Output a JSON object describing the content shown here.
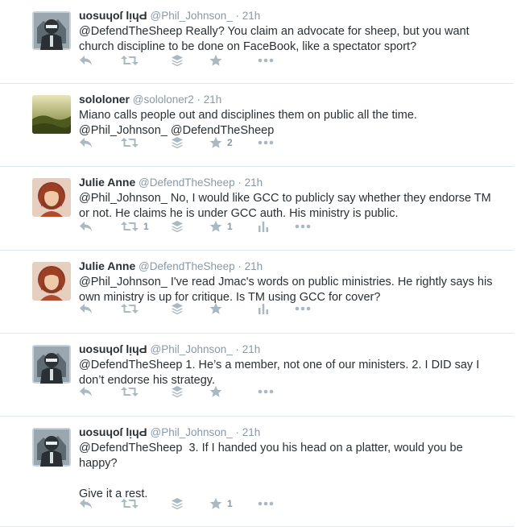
{
  "tweets": [
    {
      "fullname": "uosuɥoſ lᴉɥԀ",
      "username": "@Phil_Johnson_",
      "time": "21h",
      "text": "@DefendTheSheep Really? You claim an advocate for sheep, but you want church discipline to be done on FaceBook, like a spectator sport?",
      "avatar": "phil",
      "retweets": "",
      "favorites": "",
      "has_stats": false
    },
    {
      "fullname": "sololoner",
      "username": "@sololoner2",
      "time": "21h",
      "text": "Miano calls people out and disciplines them on public all the time. @Phil_Johnson_ @DefendTheSheep",
      "avatar": "sololoner",
      "retweets": "",
      "favorites": "2",
      "has_stats": false
    },
    {
      "fullname": "Julie Anne",
      "username": "@DefendTheSheep",
      "time": "21h",
      "text": "@Phil_Johnson_ No, I would like GCC to publicly say whether they endorse TM or not. He claims he is under GCC auth. His ministry is public.",
      "avatar": "julie",
      "retweets": "1",
      "favorites": "1",
      "has_stats": true
    },
    {
      "fullname": "Julie Anne",
      "username": "@DefendTheSheep",
      "time": "21h",
      "text": "@Phil_Johnson_ I've read Jmac's words on public ministries. He rightly says his own ministry is up for critique. Is TM using GCC for cover?",
      "avatar": "julie",
      "retweets": "",
      "favorites": "",
      "has_stats": true
    },
    {
      "fullname": "uosuɥoſ lᴉɥԀ",
      "username": "@Phil_Johnson_",
      "time": "21h",
      "text": "@DefendTheSheep 1. He’s a member, not one of our ministers. 2. I DID say I don’t endorse his strategy.",
      "avatar": "phil",
      "retweets": "",
      "favorites": "",
      "has_stats": false
    },
    {
      "fullname": "uosuɥoſ lᴉɥԀ",
      "username": "@Phil_Johnson_",
      "time": "21h",
      "text": "@DefendTheSheep  3. If I handed you his head on a platter, would you be happy?\n\nGive it a rest.",
      "avatar": "phil",
      "retweets": "",
      "favorites": "1",
      "has_stats": false
    }
  ],
  "colors": {
    "icon": "#aab8c2",
    "muted": "#8899a6",
    "text": "#292f33",
    "divider": "#e1e8ed"
  }
}
